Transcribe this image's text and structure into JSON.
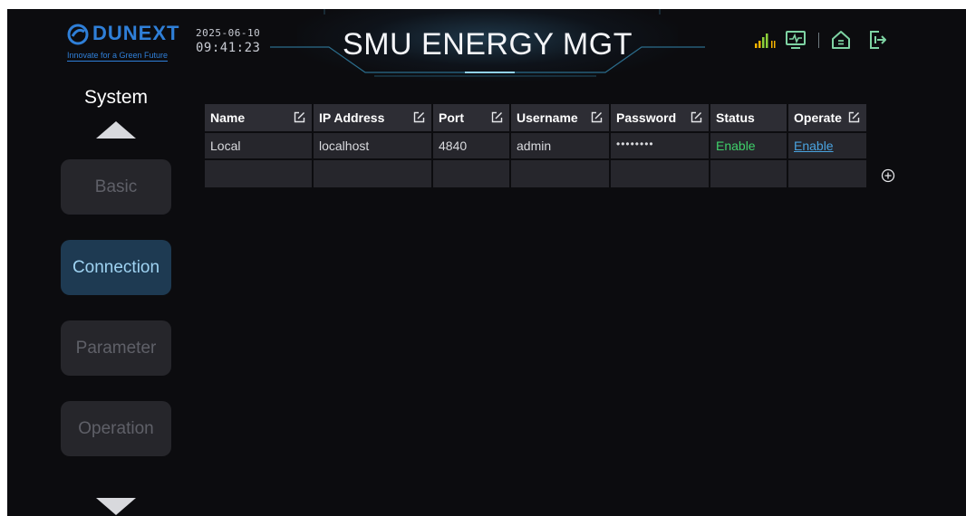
{
  "header": {
    "brand_name": "DUNEXT",
    "tagline": "Innovate for a Green Future",
    "date": "2025-06-10",
    "time": "09:41:23",
    "title": "SMU ENERGY MGT",
    "icons": [
      "signal-bars-icon",
      "monitor-chart-icon",
      "home-icon",
      "logout-door-icon"
    ],
    "accent_color": "#2f7fd8",
    "signal_color": "#f5b400",
    "icon_color": "#7ed3a3"
  },
  "sidebar": {
    "title": "System",
    "items": [
      {
        "label": "Basic",
        "active": false
      },
      {
        "label": "Connection",
        "active": true
      },
      {
        "label": "Parameter",
        "active": false
      },
      {
        "label": "Operation",
        "active": false
      }
    ]
  },
  "table": {
    "columns": [
      "Name",
      "IP Address",
      "Port",
      "Username",
      "Password",
      "Status",
      "Operate"
    ],
    "rows": [
      {
        "name": "Local",
        "ip": "localhost",
        "port": "4840",
        "username": "admin",
        "password": "••••••••",
        "status": "Enable",
        "operate": "Enable"
      }
    ],
    "status_color": "#3fd16a",
    "link_color": "#4aa3df"
  }
}
